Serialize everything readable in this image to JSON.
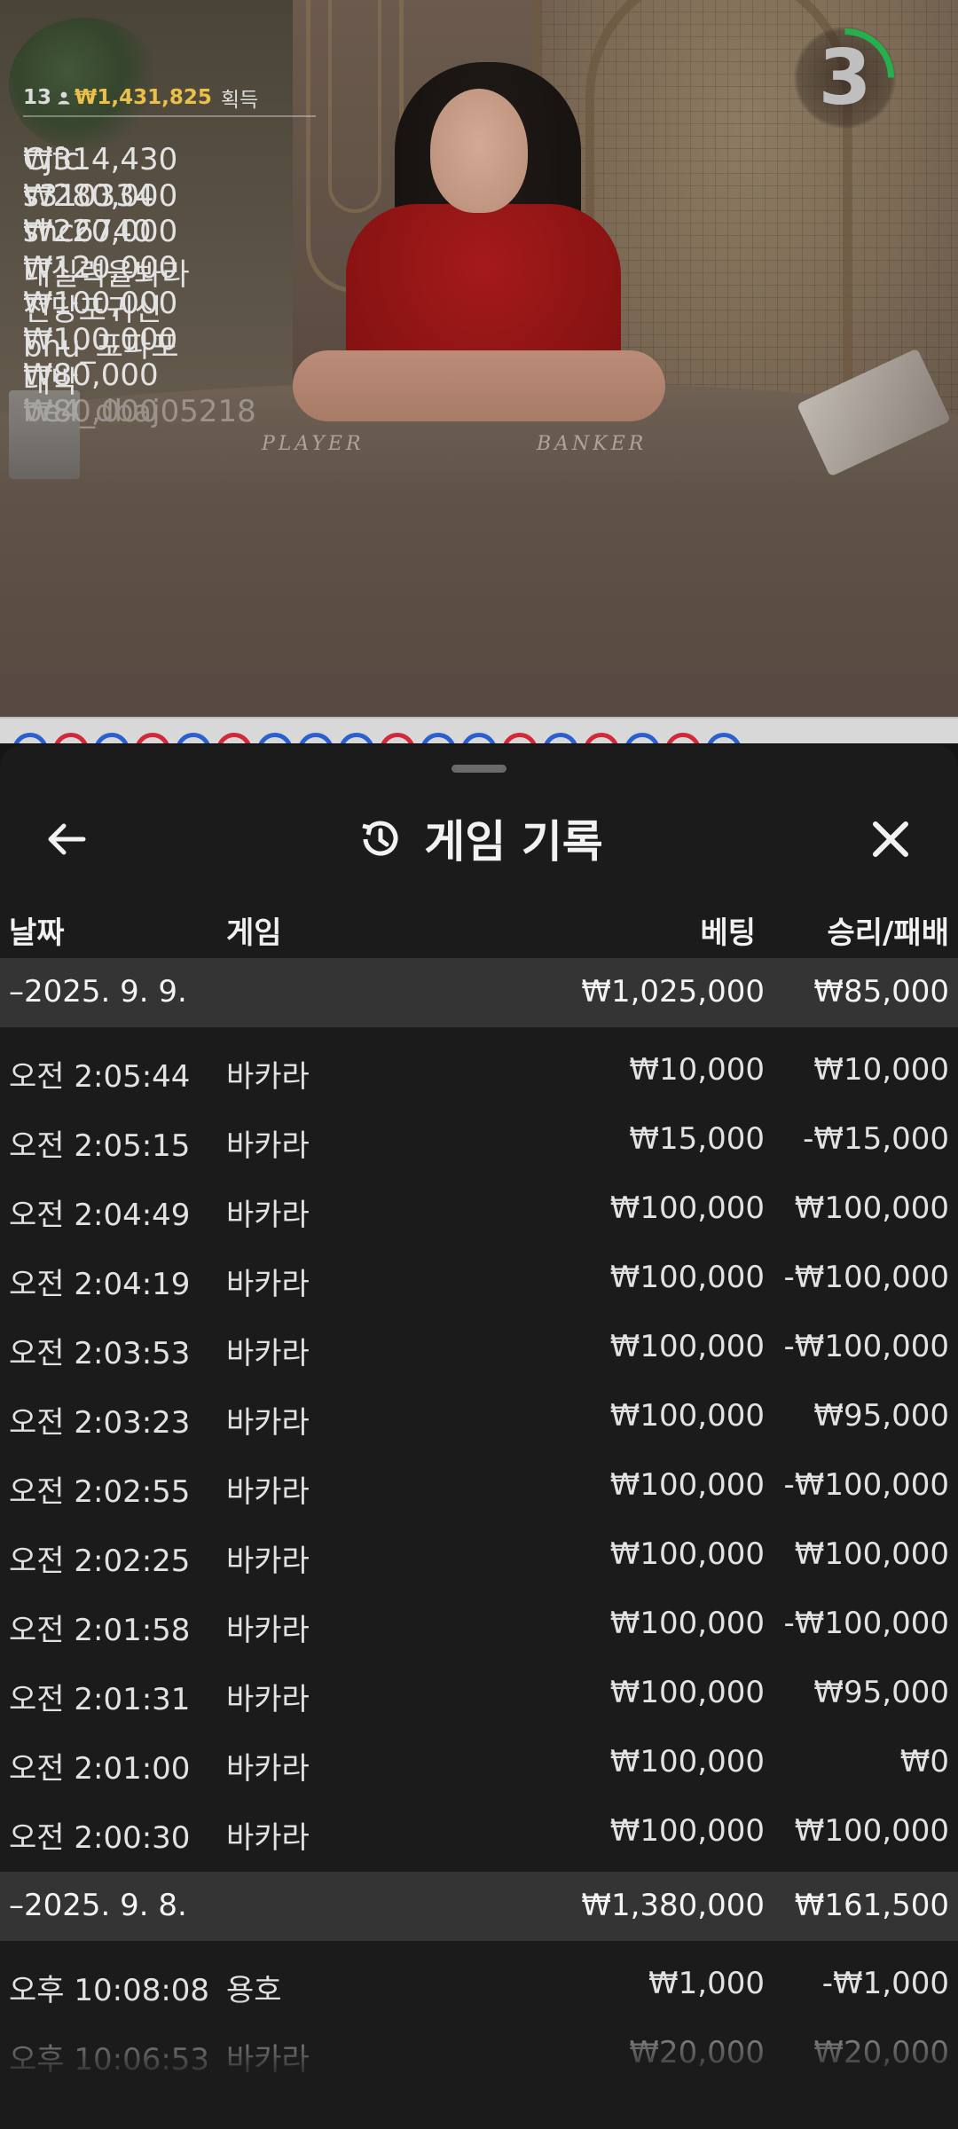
{
  "stream": {
    "table_labels": {
      "player": "PLAYER",
      "banker": "BANKER"
    },
    "countdown": "3",
    "countdown_fraction": 0.25,
    "winners": {
      "count": "13",
      "total": "₩1,431,825",
      "total_label": "획득",
      "list": [
        {
          "amount": "₩314,430",
          "user": "Cjfc"
        },
        {
          "amount": "₩280,000",
          "user": "s310334"
        },
        {
          "amount": "₩220,000",
          "user": "shc6740"
        },
        {
          "amount": "₩120,000",
          "user": "내실력을봐라"
        },
        {
          "amount": "₩100,000",
          "user": "전당포귀신"
        },
        {
          "amount": "₩100,000",
          "user": "bhu_포파포"
        },
        {
          "amount": "₩80,000",
          "user": "대박"
        },
        {
          "amount": "₩80,000",
          "user": "be4_dbaj05218"
        }
      ]
    },
    "colors": {
      "player": "#2a5fd0",
      "banker": "#d3283a",
      "timer": "#22b14c",
      "total": "#e8c04a"
    }
  },
  "sheet": {
    "title": "게임 기록",
    "columns": {
      "date": "날짜",
      "game": "게임",
      "bet": "베팅",
      "result": "승리/패배"
    },
    "groups": [
      {
        "date": "–2025. 9. 9.",
        "bet_total": "₩1,025,000",
        "result_total": "₩85,000",
        "rows": [
          {
            "time": "오전 2:05:44",
            "game": "바카라",
            "bet": "₩10,000",
            "result": "₩10,000"
          },
          {
            "time": "오전 2:05:15",
            "game": "바카라",
            "bet": "₩15,000",
            "result": "-₩15,000"
          },
          {
            "time": "오전 2:04:49",
            "game": "바카라",
            "bet": "₩100,000",
            "result": "₩100,000"
          },
          {
            "time": "오전 2:04:19",
            "game": "바카라",
            "bet": "₩100,000",
            "result": "-₩100,000"
          },
          {
            "time": "오전 2:03:53",
            "game": "바카라",
            "bet": "₩100,000",
            "result": "-₩100,000"
          },
          {
            "time": "오전 2:03:23",
            "game": "바카라",
            "bet": "₩100,000",
            "result": "₩95,000"
          },
          {
            "time": "오전 2:02:55",
            "game": "바카라",
            "bet": "₩100,000",
            "result": "-₩100,000"
          },
          {
            "time": "오전 2:02:25",
            "game": "바카라",
            "bet": "₩100,000",
            "result": "₩100,000"
          },
          {
            "time": "오전 2:01:58",
            "game": "바카라",
            "bet": "₩100,000",
            "result": "-₩100,000"
          },
          {
            "time": "오전 2:01:31",
            "game": "바카라",
            "bet": "₩100,000",
            "result": "₩95,000"
          },
          {
            "time": "오전 2:01:00",
            "game": "바카라",
            "bet": "₩100,000",
            "result": "₩0"
          },
          {
            "time": "오전 2:00:30",
            "game": "바카라",
            "bet": "₩100,000",
            "result": "₩100,000"
          }
        ]
      },
      {
        "date": "–2025. 9. 8.",
        "bet_total": "₩1,380,000",
        "result_total": "₩161,500",
        "rows": [
          {
            "time": "오후 10:08:08",
            "game": "용호",
            "bet": "₩1,000",
            "result": "-₩1,000"
          },
          {
            "time": "오후 10:06:53",
            "game": "바카라",
            "bet": "₩20,000",
            "result": "₩20,000"
          }
        ]
      }
    ]
  }
}
